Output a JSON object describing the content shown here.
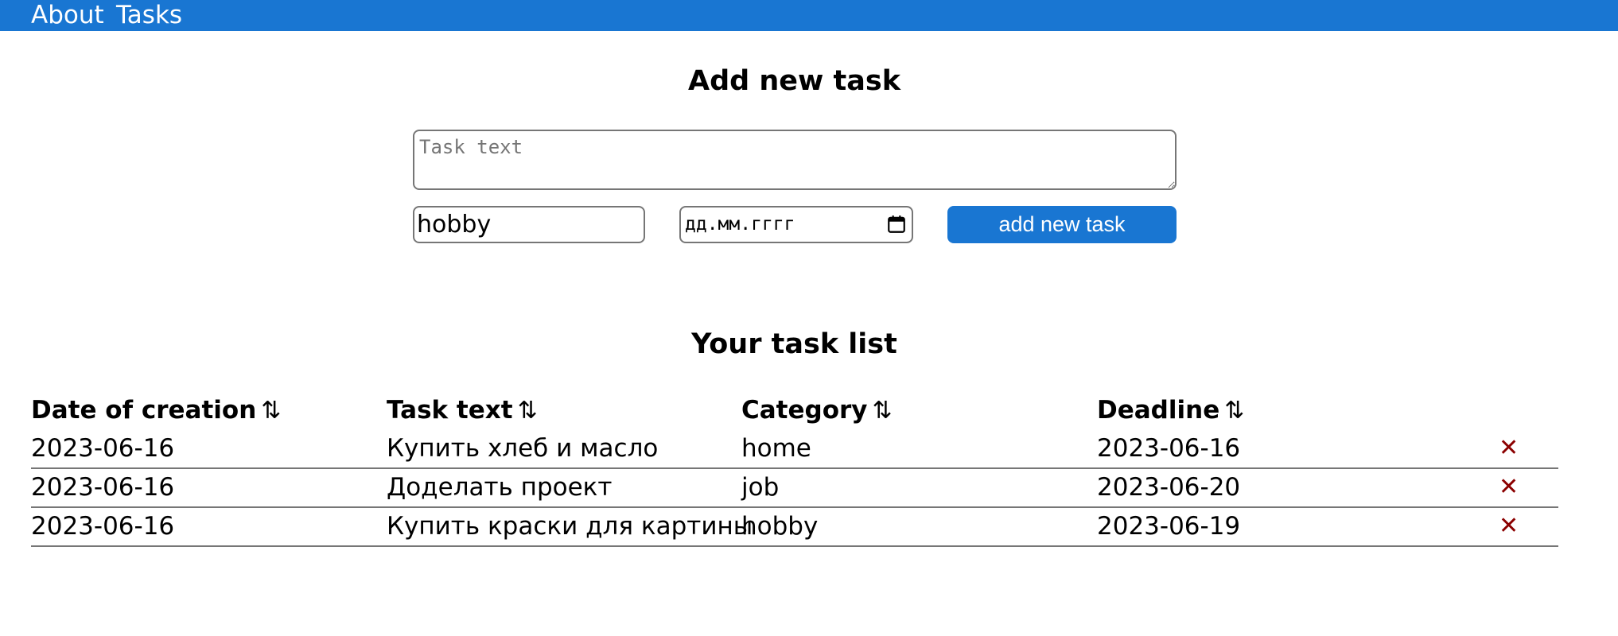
{
  "nav": {
    "about": "About",
    "tasks": "Tasks",
    "background_color": "#1976d2"
  },
  "add_form": {
    "title": "Add new task",
    "task_text_placeholder": "Task text",
    "category_value": "hobby",
    "date_placeholder": "дд.мм.гггг",
    "submit_label": "add new task",
    "submit_color": "#1976d2"
  },
  "task_list": {
    "title": "Your task list",
    "columns": [
      {
        "label": "Date of creation",
        "sort_icon": "sort-arrows-icon"
      },
      {
        "label": "Task text",
        "sort_icon": "sort-arrows-icon"
      },
      {
        "label": "Category",
        "sort_icon": "sort-arrows-icon"
      },
      {
        "label": "Deadline",
        "sort_icon": "sort-arrows-icon"
      }
    ],
    "sort_glyph": "⇅",
    "delete_glyph": "✕",
    "delete_color": "#8b0000",
    "rows": [
      {
        "created": "2023-06-16",
        "text": "Купить хлеб и масло",
        "category": "home",
        "deadline": "2023-06-16"
      },
      {
        "created": "2023-06-16",
        "text": "Доделать проект",
        "category": "job",
        "deadline": "2023-06-20"
      },
      {
        "created": "2023-06-16",
        "text": "Купить краски для картины",
        "category": "hobby",
        "deadline": "2023-06-19"
      }
    ]
  }
}
